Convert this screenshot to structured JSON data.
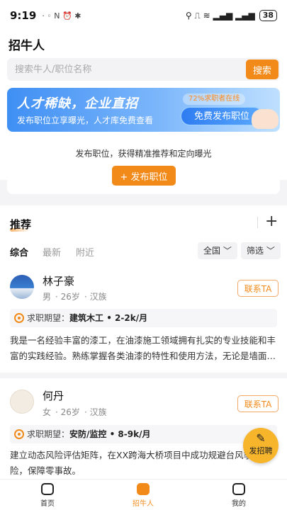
{
  "status_bar": {
    "time": "9:19",
    "left_icons": "· ◦ N ⏰ ✱",
    "right_icons": "⚲ ⎍ ≋ ▂▄▆ ▂▄▆",
    "battery": "38"
  },
  "page": {
    "title": "招牛人"
  },
  "search": {
    "placeholder": "搜索牛人/职位名称",
    "button": "搜索"
  },
  "banner": {
    "title": "人才稀缺，企业直招",
    "subtitle": "发布职位立享曝光，人才库免费查看",
    "badge": "72%求职者在线",
    "button": "免费发布职位"
  },
  "publish": {
    "text": "发布职位，获得精准推荐和定向曝光",
    "button": "+ 发布职位"
  },
  "feed": {
    "title": "推荐",
    "tabs": [
      "综合",
      "最新",
      "附近"
    ],
    "filters": [
      "全国 ﹀",
      "筛选 ﹀"
    ],
    "candidates": [
      {
        "name": "林子豪",
        "gender": "男",
        "age": "26岁",
        "ethnicity": "汉族",
        "contact": "联系TA",
        "expect_label": "求职期望：",
        "expect_value": "建筑木工 • 2-2k/月",
        "description": "我是一名经验丰富的漆工，在油漆施工领域拥有扎实的专业技能和丰富的实践经验。熟练掌握各类油漆的特性和使用方法，无论是墙面…"
      },
      {
        "name": "何丹",
        "gender": "女",
        "age": "26岁",
        "ethnicity": "汉族",
        "contact": "联系TA",
        "expect_label": "求职期望：",
        "expect_value": "安防/监控 • 8-9k/月",
        "description": "建立动态风险评估矩阵，在XX跨海大桥项目中成功规避台风季节风险，保障零事故。"
      }
    ]
  },
  "fab": {
    "label": "发招聘",
    "icon": "✎"
  },
  "tabbar": {
    "items": [
      "首页",
      "招牛人",
      "我的"
    ]
  },
  "colors": {
    "accent": "#f28a1a",
    "banner_blue": "#3f8ff4",
    "fab": "#f7b52b"
  }
}
